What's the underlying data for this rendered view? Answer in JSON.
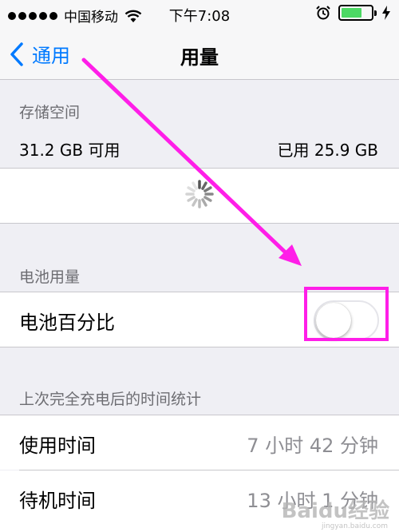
{
  "status_bar": {
    "carrier": "中国移动",
    "time": "下午7:08",
    "battery_level": 0.7,
    "colors": {
      "battery": "#4cd964"
    }
  },
  "nav": {
    "back_label": "通用",
    "title": "用量",
    "colors": {
      "accent": "#007aff"
    }
  },
  "storage": {
    "header": "存储空间",
    "available": "31.2 GB 可用",
    "used": "已用 25.9 GB"
  },
  "battery_usage": {
    "header": "电池用量",
    "percentage_label": "电池百分比",
    "percentage_enabled": false
  },
  "time_stats": {
    "header": "上次完全充电后的时间统计",
    "rows": [
      {
        "label": "使用时间",
        "value": "7 小时 42 分钟"
      },
      {
        "label": "待机时间",
        "value": "13 小时 1 分钟"
      }
    ]
  },
  "annotation": {
    "color": "#ff1ee8"
  },
  "watermark": {
    "text": "Baidu经验",
    "sub": "jingyan.baidu.com"
  }
}
